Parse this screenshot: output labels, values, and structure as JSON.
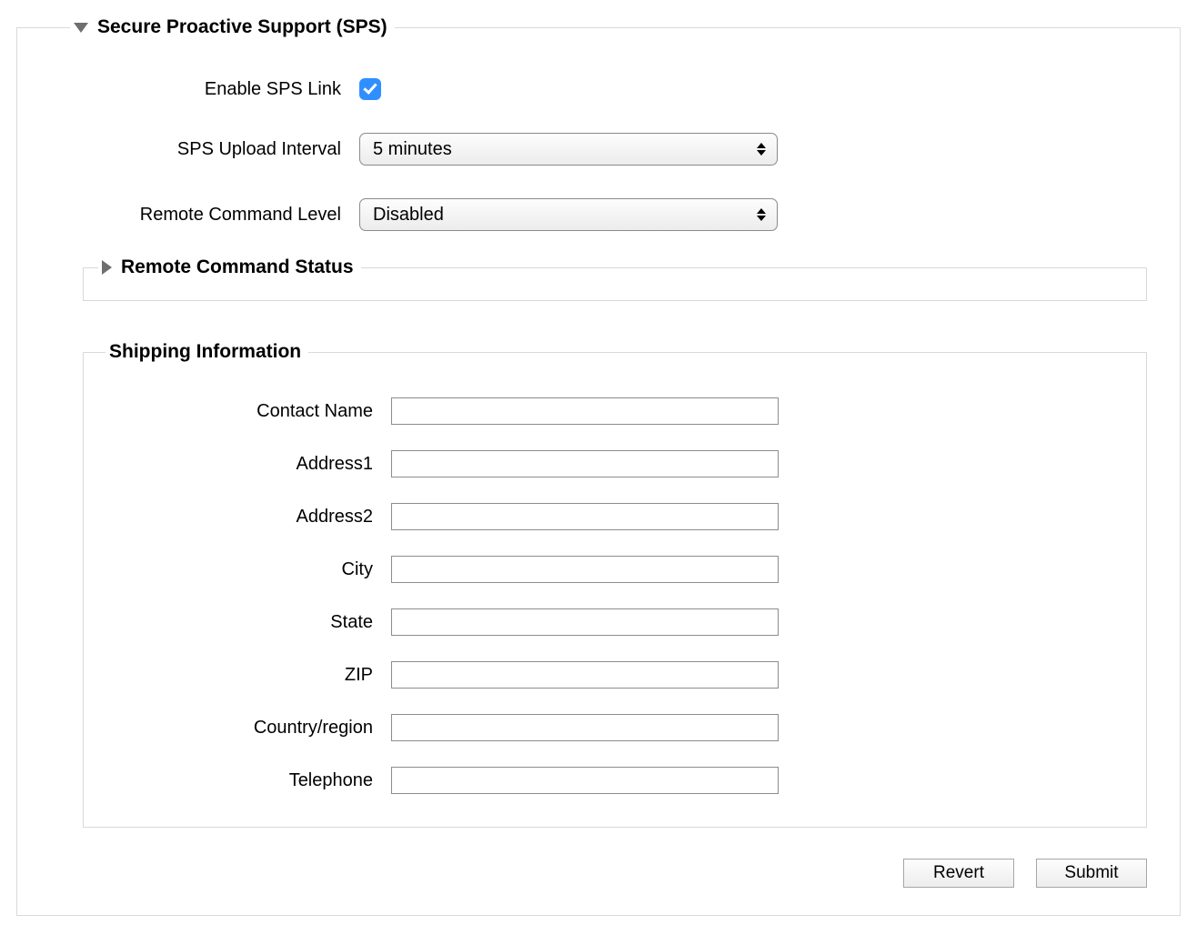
{
  "sps": {
    "legend": "Secure Proactive Support (SPS)",
    "enable_label": "Enable SPS Link",
    "enable_checked": true,
    "interval_label": "SPS Upload Interval",
    "interval_value": "5 minutes",
    "level_label": "Remote Command Level",
    "level_value": "Disabled"
  },
  "status": {
    "legend": "Remote Command Status"
  },
  "shipping": {
    "legend": "Shipping Information",
    "fields": {
      "contact": {
        "label": "Contact Name",
        "value": ""
      },
      "address1": {
        "label": "Address1",
        "value": ""
      },
      "address2": {
        "label": "Address2",
        "value": ""
      },
      "city": {
        "label": "City",
        "value": ""
      },
      "state": {
        "label": "State",
        "value": ""
      },
      "zip": {
        "label": "ZIP",
        "value": ""
      },
      "country": {
        "label": "Country/region",
        "value": ""
      },
      "telephone": {
        "label": "Telephone",
        "value": ""
      }
    }
  },
  "buttons": {
    "revert": "Revert",
    "submit": "Submit"
  }
}
